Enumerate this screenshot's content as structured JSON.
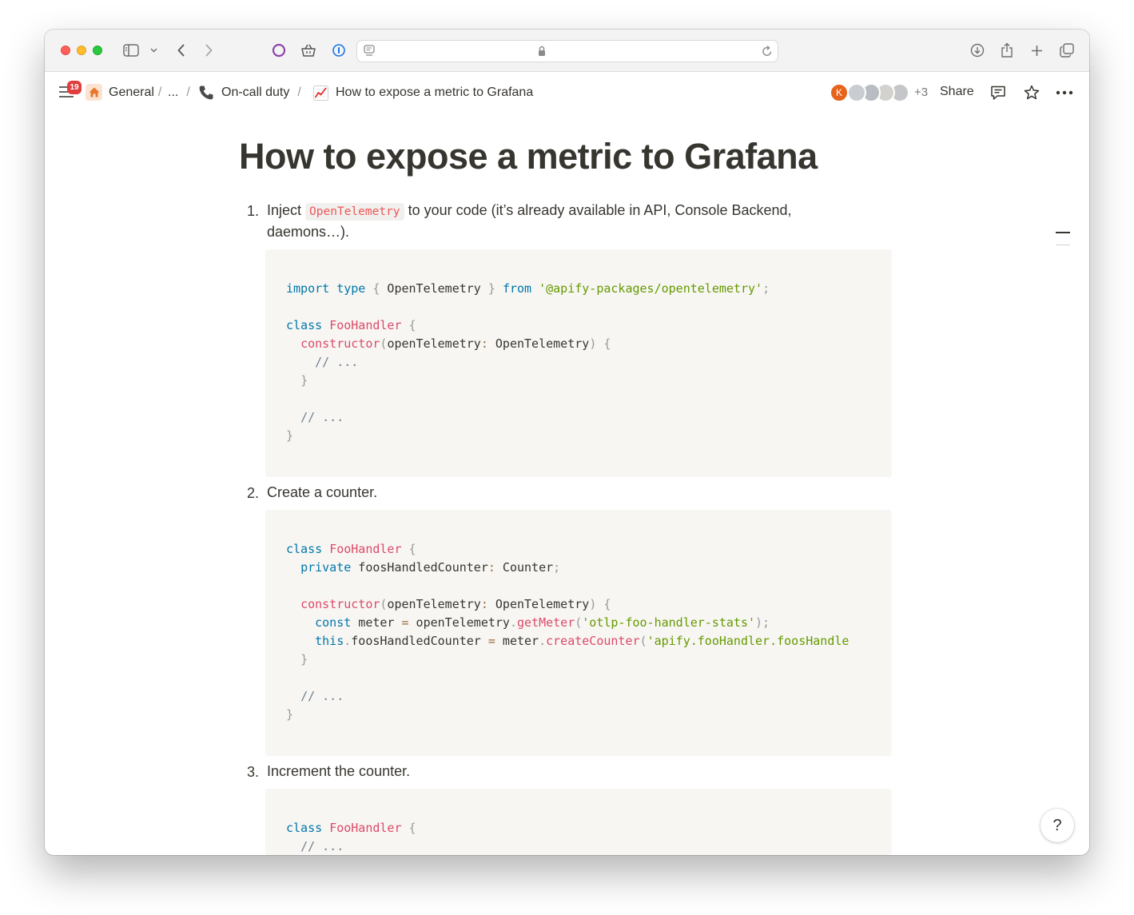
{
  "browser": {
    "url_text": ""
  },
  "topbar": {
    "notification_count": "19",
    "breadcrumbs": [
      {
        "icon": "house-icon",
        "label": "General"
      },
      {
        "label": "..."
      },
      {
        "icon": "phone-icon",
        "label": "On-call duty"
      },
      {
        "icon": "chart-up-icon",
        "label": "How to expose a metric to Grafana"
      }
    ],
    "separator": "/",
    "avatar_initial": "K",
    "extra_collaborators": "+3",
    "share_label": "Share"
  },
  "page": {
    "title": "How to expose a metric to Grafana",
    "steps": [
      {
        "number": "1.",
        "text_before": "Inject",
        "inline_code": "OpenTelemetry",
        "text_after": "to your code (it’s already available in API, Console Backend,",
        "text_line2": "daemons…)."
      },
      {
        "number": "2.",
        "text": "Create a counter."
      },
      {
        "number": "3.",
        "text": "Increment the counter."
      }
    ],
    "code_blocks": [
      {
        "lines": [
          "import type { OpenTelemetry } from '@apify-packages/opentelemetry';",
          "",
          "class FooHandler {",
          "  constructor(openTelemetry: OpenTelemetry) {",
          "    // ...",
          "  }",
          "",
          "  // ...",
          "}"
        ]
      },
      {
        "lines": [
          "class FooHandler {",
          "  private foosHandledCounter: Counter;",
          "",
          "  constructor(openTelemetry: OpenTelemetry) {",
          "    const meter = openTelemetry.getMeter('otlp-foo-handler-stats');",
          "    this.foosHandledCounter = meter.createCounter('apify.fooHandler.foosHandle",
          "  }",
          "",
          "  // ...",
          "}"
        ]
      },
      {
        "lines": [
          "class FooHandler {",
          "  // ..."
        ]
      }
    ]
  },
  "help_button": {
    "icon": "help-icon",
    "glyph": "?"
  }
}
